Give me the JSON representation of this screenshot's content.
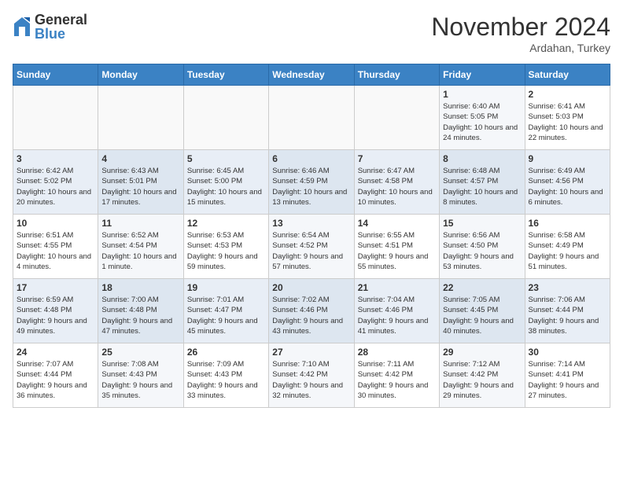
{
  "header": {
    "logo": {
      "general": "General",
      "blue": "Blue"
    },
    "title": "November 2024",
    "location": "Ardahan, Turkey"
  },
  "weekdays": [
    "Sunday",
    "Monday",
    "Tuesday",
    "Wednesday",
    "Thursday",
    "Friday",
    "Saturday"
  ],
  "weeks": [
    [
      {
        "day": "",
        "info": ""
      },
      {
        "day": "",
        "info": ""
      },
      {
        "day": "",
        "info": ""
      },
      {
        "day": "",
        "info": ""
      },
      {
        "day": "",
        "info": ""
      },
      {
        "day": "1",
        "info": "Sunrise: 6:40 AM\nSunset: 5:05 PM\nDaylight: 10 hours and 24 minutes."
      },
      {
        "day": "2",
        "info": "Sunrise: 6:41 AM\nSunset: 5:03 PM\nDaylight: 10 hours and 22 minutes."
      }
    ],
    [
      {
        "day": "3",
        "info": "Sunrise: 6:42 AM\nSunset: 5:02 PM\nDaylight: 10 hours and 20 minutes."
      },
      {
        "day": "4",
        "info": "Sunrise: 6:43 AM\nSunset: 5:01 PM\nDaylight: 10 hours and 17 minutes."
      },
      {
        "day": "5",
        "info": "Sunrise: 6:45 AM\nSunset: 5:00 PM\nDaylight: 10 hours and 15 minutes."
      },
      {
        "day": "6",
        "info": "Sunrise: 6:46 AM\nSunset: 4:59 PM\nDaylight: 10 hours and 13 minutes."
      },
      {
        "day": "7",
        "info": "Sunrise: 6:47 AM\nSunset: 4:58 PM\nDaylight: 10 hours and 10 minutes."
      },
      {
        "day": "8",
        "info": "Sunrise: 6:48 AM\nSunset: 4:57 PM\nDaylight: 10 hours and 8 minutes."
      },
      {
        "day": "9",
        "info": "Sunrise: 6:49 AM\nSunset: 4:56 PM\nDaylight: 10 hours and 6 minutes."
      }
    ],
    [
      {
        "day": "10",
        "info": "Sunrise: 6:51 AM\nSunset: 4:55 PM\nDaylight: 10 hours and 4 minutes."
      },
      {
        "day": "11",
        "info": "Sunrise: 6:52 AM\nSunset: 4:54 PM\nDaylight: 10 hours and 1 minute."
      },
      {
        "day": "12",
        "info": "Sunrise: 6:53 AM\nSunset: 4:53 PM\nDaylight: 9 hours and 59 minutes."
      },
      {
        "day": "13",
        "info": "Sunrise: 6:54 AM\nSunset: 4:52 PM\nDaylight: 9 hours and 57 minutes."
      },
      {
        "day": "14",
        "info": "Sunrise: 6:55 AM\nSunset: 4:51 PM\nDaylight: 9 hours and 55 minutes."
      },
      {
        "day": "15",
        "info": "Sunrise: 6:56 AM\nSunset: 4:50 PM\nDaylight: 9 hours and 53 minutes."
      },
      {
        "day": "16",
        "info": "Sunrise: 6:58 AM\nSunset: 4:49 PM\nDaylight: 9 hours and 51 minutes."
      }
    ],
    [
      {
        "day": "17",
        "info": "Sunrise: 6:59 AM\nSunset: 4:48 PM\nDaylight: 9 hours and 49 minutes."
      },
      {
        "day": "18",
        "info": "Sunrise: 7:00 AM\nSunset: 4:48 PM\nDaylight: 9 hours and 47 minutes."
      },
      {
        "day": "19",
        "info": "Sunrise: 7:01 AM\nSunset: 4:47 PM\nDaylight: 9 hours and 45 minutes."
      },
      {
        "day": "20",
        "info": "Sunrise: 7:02 AM\nSunset: 4:46 PM\nDaylight: 9 hours and 43 minutes."
      },
      {
        "day": "21",
        "info": "Sunrise: 7:04 AM\nSunset: 4:46 PM\nDaylight: 9 hours and 41 minutes."
      },
      {
        "day": "22",
        "info": "Sunrise: 7:05 AM\nSunset: 4:45 PM\nDaylight: 9 hours and 40 minutes."
      },
      {
        "day": "23",
        "info": "Sunrise: 7:06 AM\nSunset: 4:44 PM\nDaylight: 9 hours and 38 minutes."
      }
    ],
    [
      {
        "day": "24",
        "info": "Sunrise: 7:07 AM\nSunset: 4:44 PM\nDaylight: 9 hours and 36 minutes."
      },
      {
        "day": "25",
        "info": "Sunrise: 7:08 AM\nSunset: 4:43 PM\nDaylight: 9 hours and 35 minutes."
      },
      {
        "day": "26",
        "info": "Sunrise: 7:09 AM\nSunset: 4:43 PM\nDaylight: 9 hours and 33 minutes."
      },
      {
        "day": "27",
        "info": "Sunrise: 7:10 AM\nSunset: 4:42 PM\nDaylight: 9 hours and 32 minutes."
      },
      {
        "day": "28",
        "info": "Sunrise: 7:11 AM\nSunset: 4:42 PM\nDaylight: 9 hours and 30 minutes."
      },
      {
        "day": "29",
        "info": "Sunrise: 7:12 AM\nSunset: 4:42 PM\nDaylight: 9 hours and 29 minutes."
      },
      {
        "day": "30",
        "info": "Sunrise: 7:14 AM\nSunset: 4:41 PM\nDaylight: 9 hours and 27 minutes."
      }
    ]
  ]
}
